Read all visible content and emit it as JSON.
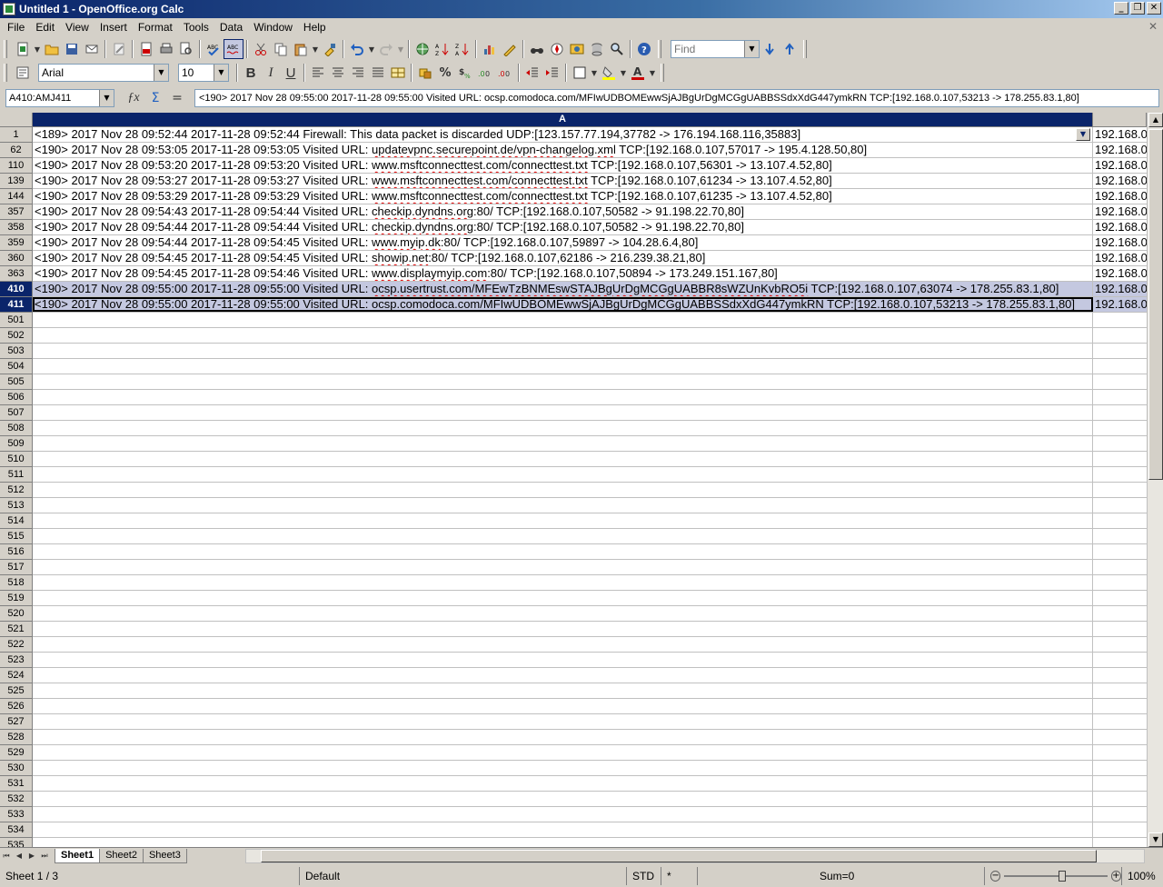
{
  "window": {
    "title": "Untitled 1 - OpenOffice.org Calc",
    "min": "_",
    "restore": "❐",
    "close": "✕",
    "doc_close": "✕"
  },
  "menu": [
    {
      "label": "File"
    },
    {
      "label": "Edit"
    },
    {
      "label": "View"
    },
    {
      "label": "Insert"
    },
    {
      "label": "Format"
    },
    {
      "label": "Tools"
    },
    {
      "label": "Data"
    },
    {
      "label": "Window"
    },
    {
      "label": "Help"
    }
  ],
  "find": {
    "placeholder": "Find"
  },
  "format": {
    "font_name": "Arial",
    "font_size": "10"
  },
  "formula": {
    "name_box": "A410:AMJ411",
    "content": "<190> 2017 Nov 28 09:55:00 2017-11-28 09:55:00 Visited URL: ocsp.comodoca.com/MFIwUDBOMEwwSjAJBgUrDgMCGgUABBSSdxXdG447ymkRN TCP:[192.168.0.107,53213 -> 178.255.83.1,80]"
  },
  "columns": {
    "a": "A",
    "b": ""
  },
  "rows": [
    {
      "num": "1",
      "pre": "<189> 2017 Nov 28 09:52:44 2017-11-28 09:52:44 Firewall: This data packet is discarded UDP:[123.157.77.194,37782 -> 176.194.168.116,35883]",
      "url": "",
      "post": "",
      "b": "192.168.0"
    },
    {
      "num": "62",
      "pre": "<190> 2017 Nov 28 09:53:05 2017-11-28 09:53:05 Visited URL: ",
      "url": "updatevpnc.securepoint.de/vpn-changelog.xml",
      "post": " TCP:[192.168.0.107,57017 -> 195.4.128.50,80]",
      "b": "192.168.0"
    },
    {
      "num": "110",
      "pre": "<190> 2017 Nov 28 09:53:20 2017-11-28 09:53:20 Visited URL: ",
      "url": "www.msftconnecttest.com/connecttest.txt",
      "post": " TCP:[192.168.0.107,56301 -> 13.107.4.52,80]",
      "b": "192.168.0"
    },
    {
      "num": "139",
      "pre": "<190> 2017 Nov 28 09:53:27 2017-11-28 09:53:27 Visited URL: ",
      "url": "www.msftconnecttest.com/connecttest.txt",
      "post": " TCP:[192.168.0.107,61234 -> 13.107.4.52,80]",
      "b": "192.168.0"
    },
    {
      "num": "144",
      "pre": "<190> 2017 Nov 28 09:53:29 2017-11-28 09:53:29 Visited URL: ",
      "url": "www.msftconnecttest.com/connecttest.txt",
      "post": " TCP:[192.168.0.107,61235 -> 13.107.4.52,80]",
      "b": "192.168.0"
    },
    {
      "num": "357",
      "pre": "<190> 2017 Nov 28 09:54:43 2017-11-28 09:54:44 Visited URL: ",
      "url": "checkip.dyndns.org",
      "post": ":80/ TCP:[192.168.0.107,50582 -> 91.198.22.70,80]",
      "b": "192.168.0"
    },
    {
      "num": "358",
      "pre": "<190> 2017 Nov 28 09:54:44 2017-11-28 09:54:44 Visited URL: ",
      "url": "checkip.dyndns.org",
      "post": ":80/ TCP:[192.168.0.107,50582 -> 91.198.22.70,80]",
      "b": "192.168.0"
    },
    {
      "num": "359",
      "pre": "<190> 2017 Nov 28 09:54:44 2017-11-28 09:54:45 Visited URL: ",
      "url": "www.myip.dk",
      "post": ":80/ TCP:[192.168.0.107,59897 -> 104.28.6.4,80]",
      "b": "192.168.0"
    },
    {
      "num": "360",
      "pre": "<190> 2017 Nov 28 09:54:45 2017-11-28 09:54:45 Visited URL: ",
      "url": "showip.net",
      "post": ":80/ TCP:[192.168.0.107,62186 -> 216.239.38.21,80]",
      "b": "192.168.0"
    },
    {
      "num": "363",
      "pre": "<190> 2017 Nov 28 09:54:45 2017-11-28 09:54:46 Visited URL: ",
      "url": "www.displaymyip.com",
      "post": ":80/ TCP:[192.168.0.107,50894 -> 173.249.151.167,80]",
      "b": "192.168.0"
    },
    {
      "num": "410",
      "pre": "<190> 2017 Nov 28 09:55:00 2017-11-28 09:55:00 Visited URL: ",
      "url": "ocsp.usertrust.com/MFEwTzBNMEswSTAJBgUrDgMCGgUABBR8sWZUnKvbRO5i",
      "post": " TCP:[192.168.0.107,63074 -> 178.255.83.1,80]",
      "b": "192.168.0",
      "selected": true
    },
    {
      "num": "411",
      "pre": "<190> 2017 Nov 28 09:55:00 2017-11-28 09:55:00 Visited URL: ",
      "url": "ocsp.comodoca.com/MFIwUDBOMEwwSjAJBgUrDgMCGgUABBSSdxXdG447ymkRN",
      "post": " TCP:[192.168.0.107,53213 -> 178.255.83.1,80]",
      "b": "192.168.0",
      "selected": true,
      "current": true
    },
    {
      "num": "501"
    },
    {
      "num": "502"
    },
    {
      "num": "503"
    },
    {
      "num": "504"
    },
    {
      "num": "505"
    },
    {
      "num": "506"
    },
    {
      "num": "507"
    },
    {
      "num": "508"
    },
    {
      "num": "509"
    },
    {
      "num": "510"
    },
    {
      "num": "511"
    },
    {
      "num": "512"
    },
    {
      "num": "513"
    },
    {
      "num": "514"
    },
    {
      "num": "515"
    },
    {
      "num": "516"
    },
    {
      "num": "517"
    },
    {
      "num": "518"
    },
    {
      "num": "519"
    },
    {
      "num": "520"
    },
    {
      "num": "521"
    },
    {
      "num": "522"
    },
    {
      "num": "523"
    },
    {
      "num": "524"
    },
    {
      "num": "525"
    },
    {
      "num": "526"
    },
    {
      "num": "527"
    },
    {
      "num": "528"
    },
    {
      "num": "529"
    },
    {
      "num": "530"
    },
    {
      "num": "531"
    },
    {
      "num": "532"
    },
    {
      "num": "533"
    },
    {
      "num": "534"
    },
    {
      "num": "535"
    }
  ],
  "sheets": [
    {
      "label": "Sheet1",
      "active": true
    },
    {
      "label": "Sheet2"
    },
    {
      "label": "Sheet3"
    }
  ],
  "status": {
    "sheet": "Sheet 1 / 3",
    "style": "Default",
    "mode": "STD",
    "modified": "*",
    "sum": "Sum=0",
    "zoom": "100%"
  },
  "colors": {
    "selection_header": "#0a246a",
    "selection_fill": "#c4c8e0",
    "spell_error": "#e00000"
  }
}
